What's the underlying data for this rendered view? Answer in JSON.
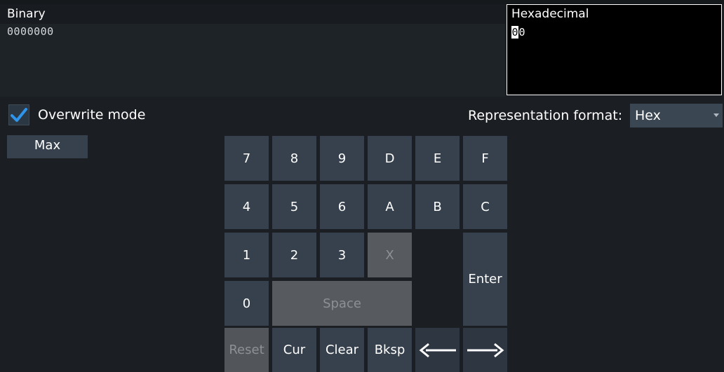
{
  "binary": {
    "title": "Binary",
    "value": "0000000"
  },
  "hexadecimal": {
    "title": "Hexadecimal",
    "cursor_digit": "0",
    "rest_digits": "0"
  },
  "overwrite": {
    "label": "Overwrite mode",
    "checked": true,
    "icon": "checkmark-icon"
  },
  "representation": {
    "label": "Representation format:",
    "selected": "Hex"
  },
  "max_button": {
    "label": "Max"
  },
  "keypad": {
    "row1": [
      "7",
      "8",
      "9",
      "D",
      "E",
      "F"
    ],
    "row2": [
      "4",
      "5",
      "6",
      "A",
      "B",
      "C"
    ],
    "row3": [
      "1",
      "2",
      "3",
      "X"
    ],
    "zero": "0",
    "space": "Space",
    "enter": "Enter",
    "bottom": [
      "Reset",
      "Cur",
      "Clear",
      "Bksp"
    ],
    "disabled_keys": [
      "X",
      "Space",
      "Reset"
    ]
  },
  "colors": {
    "accent": "#2f95ec",
    "key_bg": "#36414d",
    "key_disabled_bg": "#575b60",
    "background": "#1b1f23"
  }
}
